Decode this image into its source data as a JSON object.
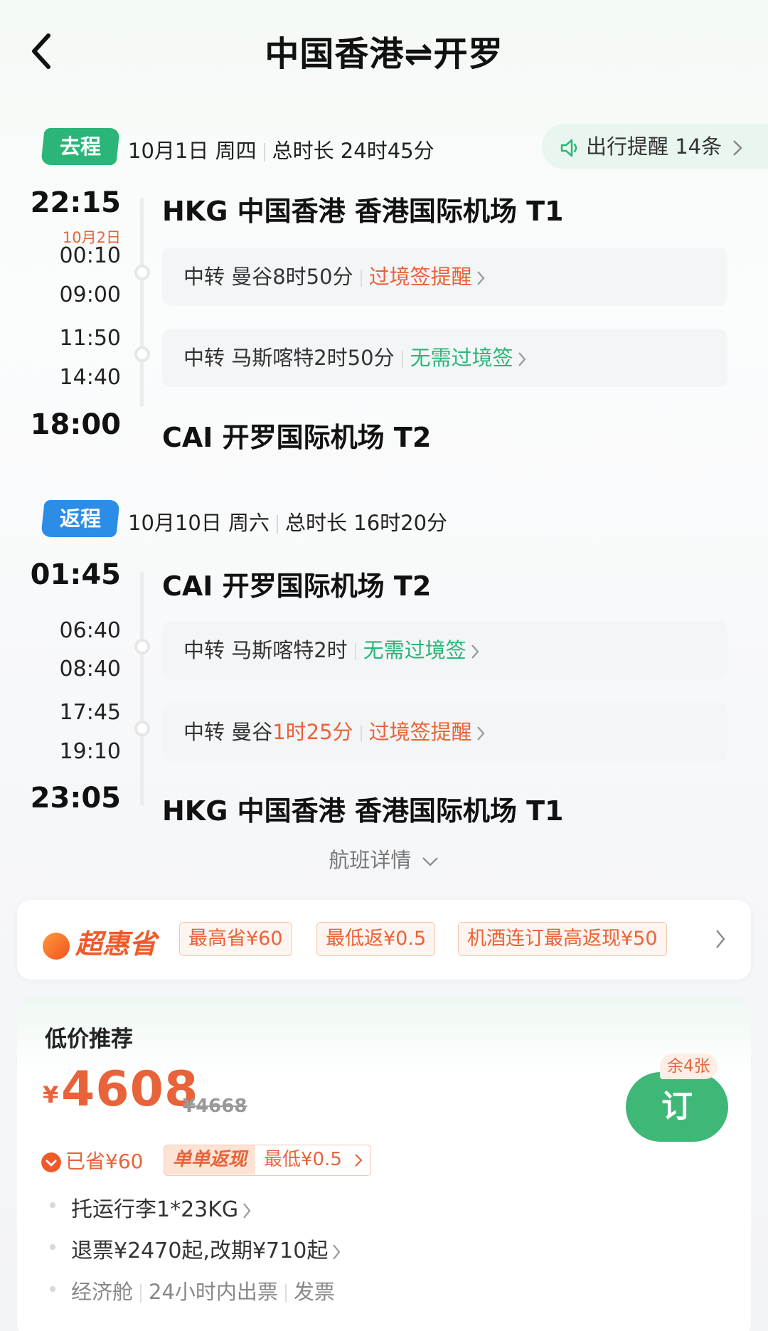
{
  "header": {
    "title": "中国香港⇌开罗"
  },
  "outbound": {
    "tag": "去程",
    "date": "10月1日 周四",
    "duration": "总时长 24时45分",
    "notice": "出行提醒 14条",
    "depart_time": "22:15",
    "depart_airport": "HKG 中国香港 香港国际机场 T1",
    "next_day": "10月2日",
    "t1_arr": "00:10",
    "t1_dep": "09:00",
    "t2_arr": "11:50",
    "t2_dep": "14:40",
    "arrive_time": "18:00",
    "arrive_airport": "CAI 开罗国际机场 T2",
    "transfer1": {
      "label": "中转 曼谷8时50分",
      "visa": "过境签提醒"
    },
    "transfer2": {
      "label": "中转 马斯喀特2时50分",
      "visa": "无需过境签"
    }
  },
  "return": {
    "tag": "返程",
    "date": "10月10日 周六",
    "duration": "总时长 16时20分",
    "depart_time": "01:45",
    "depart_airport": "CAI 开罗国际机场 T2",
    "t1_arr": "06:40",
    "t1_dep": "08:40",
    "t2_arr": "17:45",
    "t2_dep": "19:10",
    "arrive_time": "23:05",
    "arrive_airport": "HKG 中国香港 香港国际机场 T1",
    "transfer1": {
      "label": "中转 马斯喀特2时",
      "visa": "无需过境签"
    },
    "transfer2": {
      "prefix": "中转 曼谷",
      "highlight": "1时25分",
      "visa": "过境签提醒"
    }
  },
  "flight_details_label": "航班详情",
  "promo": {
    "logo": "超惠省",
    "chips": [
      "最高省¥60",
      "最低返¥0.5",
      "机酒连订最高返现¥50"
    ]
  },
  "offer": {
    "title": "低价推荐",
    "currency": "¥",
    "price": "4608",
    "original_price": "¥4668",
    "remaining": "余4张",
    "book_label": "订",
    "saved": "已省¥60",
    "cashback_label": "单单返现",
    "cashback_value": "最低¥0.5",
    "baggage": "托运行李1*23KG",
    "refund": "退票¥2470起,改期¥710起",
    "cabin": "经济舱",
    "ticketing": "24小时内出票",
    "invoice": "发票"
  },
  "colors": {
    "accent_green": "#2bb578",
    "accent_orange": "#e8633a",
    "return_blue": "#2b8de6",
    "book_green": "#3fb777"
  },
  "icons": [
    "back-arrow-icon",
    "speaker-icon",
    "chevron-right-icon",
    "chevron-down-icon",
    "fire-icon",
    "arrow-down-circle-icon"
  ]
}
